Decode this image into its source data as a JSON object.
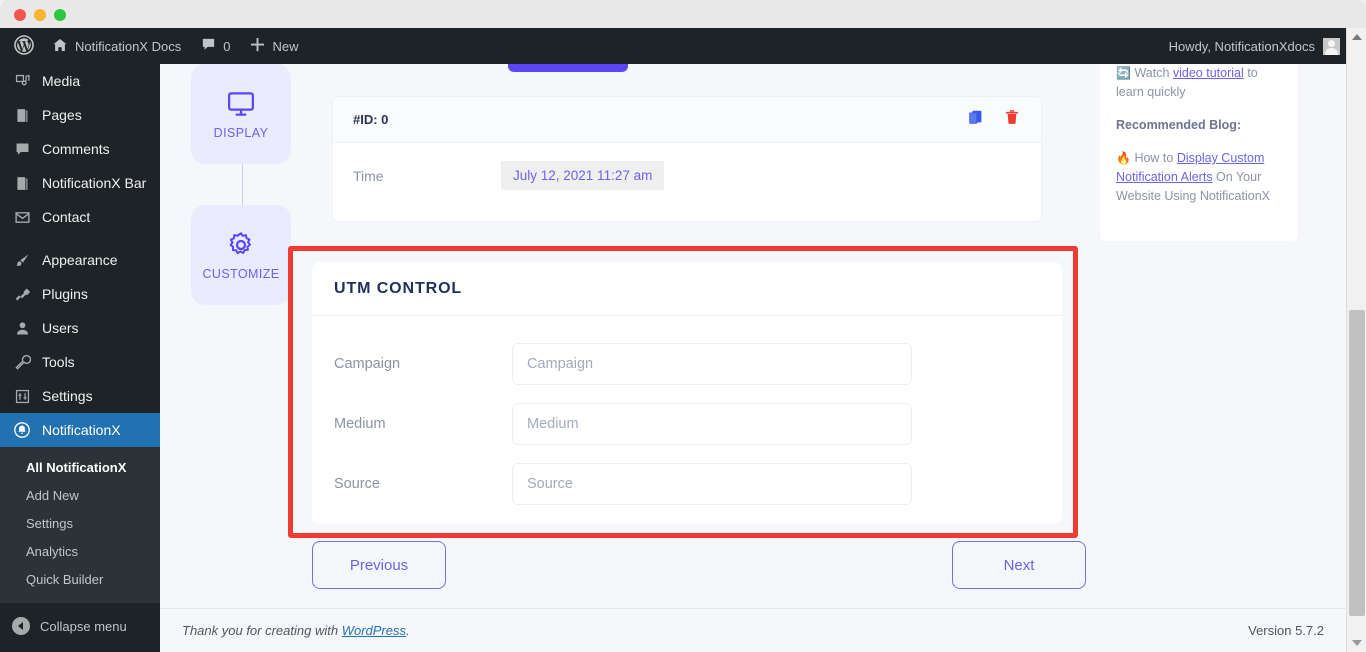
{
  "window": {
    "traffic_lights": [
      "close",
      "minimize",
      "maximize"
    ]
  },
  "adminbar": {
    "wp_logo": "wordpress-icon",
    "site_name": "NotificationX Docs",
    "comments_icon": "comment-icon",
    "comments_count": "0",
    "new_icon": "plus-icon",
    "new_label": "New",
    "howdy": "Howdy, NotificationXdocs",
    "avatar": "avatar-icon"
  },
  "sidebar": {
    "items": [
      {
        "label": "Media",
        "icon": "media-icon"
      },
      {
        "label": "Pages",
        "icon": "pages-icon"
      },
      {
        "label": "Comments",
        "icon": "comments-icon"
      },
      {
        "label": "NotificationX Bar",
        "icon": "bar-icon"
      },
      {
        "label": "Contact",
        "icon": "mail-icon"
      },
      {
        "label": "Appearance",
        "icon": "brush-icon"
      },
      {
        "label": "Plugins",
        "icon": "plug-icon"
      },
      {
        "label": "Users",
        "icon": "user-icon"
      },
      {
        "label": "Tools",
        "icon": "wrench-icon"
      },
      {
        "label": "Settings",
        "icon": "sliders-icon"
      },
      {
        "label": "NotificationX",
        "icon": "notificationx-icon"
      }
    ],
    "submenu": [
      {
        "label": "All NotificationX",
        "active": true
      },
      {
        "label": "Add New",
        "active": false
      },
      {
        "label": "Settings",
        "active": false
      },
      {
        "label": "Analytics",
        "active": false
      },
      {
        "label": "Quick Builder",
        "active": false
      }
    ],
    "collapse_label": "Collapse menu",
    "collapse_icon": "collapse-arrow-icon",
    "active_color": "#2271b1"
  },
  "steps": [
    {
      "label": "DISPLAY",
      "icon": "monitor-icon"
    },
    {
      "label": "CUSTOMIZE",
      "icon": "gear-icon"
    }
  ],
  "id_card": {
    "id_label": "#ID: 0",
    "copy_icon": "copy-icon",
    "delete_icon": "trash-icon",
    "row_label": "Time",
    "row_value": "July 12, 2021 11:27 am"
  },
  "utm": {
    "title": "UTM CONTROL",
    "fields": [
      {
        "label": "Campaign",
        "placeholder": "Campaign",
        "value": ""
      },
      {
        "label": "Medium",
        "placeholder": "Medium",
        "value": ""
      },
      {
        "label": "Source",
        "placeholder": "Source",
        "value": ""
      }
    ],
    "highlight_color": "#ef3b30"
  },
  "nav": {
    "previous": "Previous",
    "next": "Next"
  },
  "right_panel": {
    "video_icon": "video-icon",
    "watch_prefix": "Watch ",
    "watch_link": "video tutorial",
    "watch_suffix": " to learn quickly",
    "recommended_heading": "Recommended Blog:",
    "fire_icon": "fire-icon",
    "blog_prefix": "How to ",
    "blog_link": "Display Custom Notification Alerts",
    "blog_suffix": " On Your Website Using NotificationX"
  },
  "footer": {
    "thanks_prefix": "Thank you for creating with ",
    "thanks_link": "WordPress",
    "thanks_suffix": ".",
    "version": "Version 5.7.2"
  },
  "scrollbar": {
    "up_arrow": "scroll-up-icon",
    "down_arrow": "scroll-down-icon"
  }
}
